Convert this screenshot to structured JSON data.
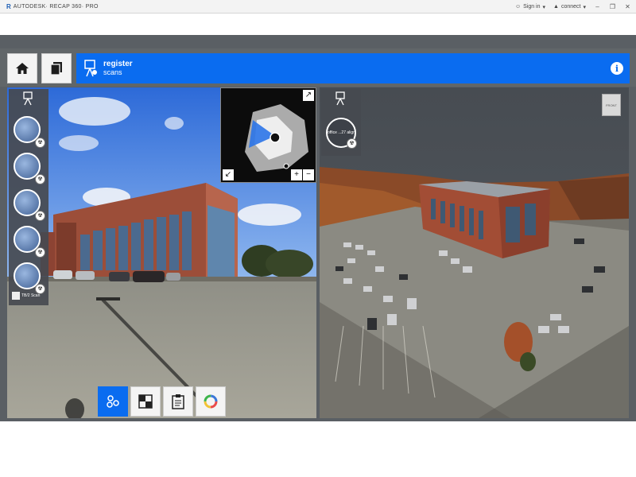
{
  "titlebar": {
    "logo": "R",
    "app_title": "AUTODESK· RECAP 360· PRO",
    "sign_in": "Sign in",
    "user_name": "connect",
    "minimize": "–",
    "restore": "❐",
    "close": "✕"
  },
  "toolbar": {
    "home_icon": "home-icon",
    "pages_icon": "pages-icon",
    "mode_title": "register",
    "mode_subtitle": "scans",
    "info_label": "i"
  },
  "left_panel": {
    "scan_count": 5,
    "footer_label": "TB/2 Scan",
    "minimap_controls": {
      "expand": "↗",
      "collapse": "↙",
      "zoom_in": "+",
      "zoom_out": "−"
    }
  },
  "right_panel": {
    "scan_label": "office ...27 align",
    "view_cube_label": "FRONT"
  },
  "bottom_tools": {
    "items": [
      "cluster-icon",
      "grid-icon",
      "clipboard-icon",
      "color-wheel-icon"
    ],
    "active_index": 0
  },
  "colors": {
    "accent": "#0a6cf0",
    "chrome": "#5a5f64",
    "sky": "#3a7ae0",
    "building": "#a3533f"
  }
}
